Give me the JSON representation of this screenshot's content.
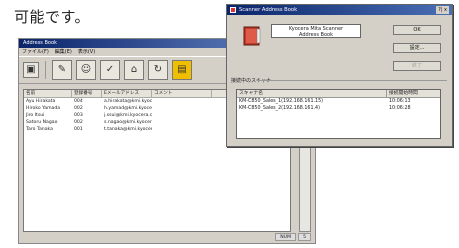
{
  "doc": {
    "text": "可能です。"
  },
  "address_book": {
    "title": "Address Book",
    "menu": [
      "ファイル(F)",
      "編集(E)",
      "表示(V)"
    ],
    "toolbar_icons": [
      "print-icon",
      "edit-icon",
      "add-user-icon",
      "check-icon",
      "scanner-icon",
      "refresh-icon",
      "book-icon"
    ],
    "columns": [
      "名前",
      "登録番号",
      "Eメールアドレス",
      "コメント"
    ],
    "rows": [
      {
        "name": "Ayu Hirakata",
        "num": "004",
        "mail": "a.hirakata@kmi.kyocera.co.."
      },
      {
        "name": "Hiroko Yamada",
        "num": "002",
        "mail": "h.yamad@kmi.kyocera.co..."
      },
      {
        "name": "Jiro Itsui",
        "num": "003",
        "mail": "j.ssui@kmi.kyocera.co..."
      },
      {
        "name": "Satoru Nagao",
        "num": "002",
        "mail": "s.nagao@kmi.kyocera.co..."
      },
      {
        "name": "Taro Tanaka",
        "num": "001",
        "mail": "t.tanaka@kmi.kyocera.co..."
      }
    ],
    "status": [
      "NUM",
      "5"
    ]
  },
  "scanner_dialog": {
    "title": "Scanner Address Book",
    "title_controls": "?| x",
    "header_line1": "Kyocera Mita Scanner",
    "header_line2": "Address Book",
    "ok_label": "OK",
    "settings_label": "設定...",
    "disabled_label": "終了",
    "group_label": "接続中のスキャナ",
    "columns": [
      "スキャナ名",
      "接続開始時間"
    ],
    "rows": [
      {
        "name": "KM-C850_Sales_1(192.168.161.15)",
        "time": "10:06:13"
      },
      {
        "name": "KM-C850_Sales_2(192.168.161.4)",
        "time": "10:06:28"
      }
    ],
    "accent_color": "#0a246a"
  }
}
